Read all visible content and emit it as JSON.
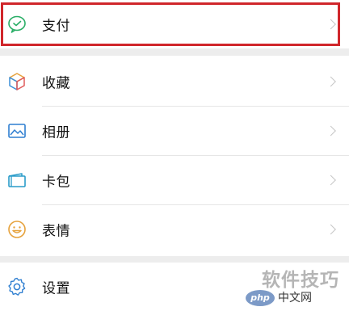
{
  "menu": {
    "pay": {
      "label": "支付",
      "icon": "wechat-pay-icon"
    },
    "favorites": {
      "label": "收藏",
      "icon": "favorites-cube-icon"
    },
    "album": {
      "label": "相册",
      "icon": "album-icon"
    },
    "card_pack": {
      "label": "卡包",
      "icon": "card-pack-icon"
    },
    "stickers": {
      "label": "表情",
      "icon": "sticker-smile-icon"
    },
    "settings": {
      "label": "设置",
      "icon": "settings-gear-icon"
    }
  },
  "highlight_color": "#d0262b",
  "watermark": {
    "text": "软件技巧",
    "badge": "php",
    "site": "中文网"
  }
}
